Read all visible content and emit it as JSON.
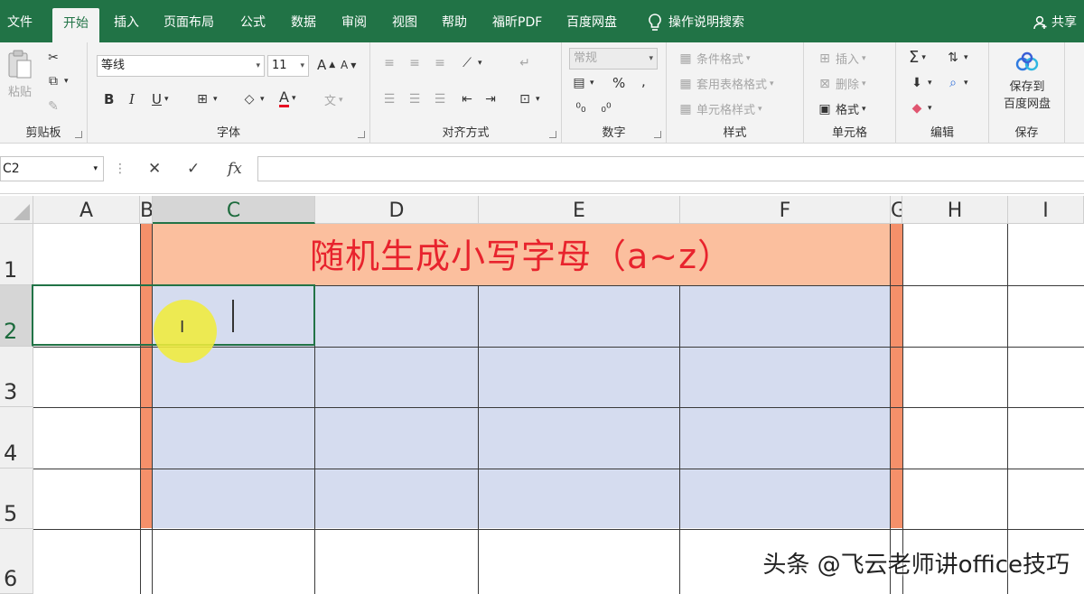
{
  "tabs": [
    {
      "label": "文件",
      "active": false
    },
    {
      "label": "开始",
      "active": true
    },
    {
      "label": "插入",
      "active": false
    },
    {
      "label": "页面布局",
      "active": false
    },
    {
      "label": "公式",
      "active": false
    },
    {
      "label": "数据",
      "active": false
    },
    {
      "label": "审阅",
      "active": false
    },
    {
      "label": "视图",
      "active": false
    },
    {
      "label": "帮助",
      "active": false
    },
    {
      "label": "福昕PDF",
      "active": false
    },
    {
      "label": "百度网盘",
      "active": false
    }
  ],
  "search_label": "操作说明搜索",
  "share_label": "共享",
  "ribbon": {
    "clipboard": {
      "group": "剪贴板",
      "paste": "粘贴"
    },
    "font": {
      "group": "字体",
      "family": "等线",
      "size": "11",
      "bold": "B",
      "italic": "I",
      "underline": "U",
      "font_color_letter": "A",
      "grow_letter": "A",
      "shrink_letter": "A",
      "phonetic": "文"
    },
    "alignment": {
      "group": "对齐方式"
    },
    "number": {
      "group": "数字",
      "format": "常规",
      "percent": "%",
      "comma": ","
    },
    "styles": {
      "group": "样式",
      "conditional": "条件格式",
      "table": "套用表格格式",
      "cell_styles": "单元格样式"
    },
    "cells": {
      "group": "单元格",
      "insert": "插入",
      "delete": "删除",
      "format": "格式"
    },
    "editing": {
      "group": "编辑",
      "sigma": "Σ"
    },
    "save": {
      "group": "保存",
      "line1": "保存到",
      "line2": "百度网盘"
    }
  },
  "formula_bar": {
    "name_box": "C2",
    "cancel": "✕",
    "enter": "✓",
    "fx": "fx",
    "value": ""
  },
  "columns": [
    "A",
    "B",
    "C",
    "D",
    "E",
    "F",
    "G",
    "H",
    "I"
  ],
  "rows": [
    "1",
    "2",
    "3",
    "4",
    "5",
    "6"
  ],
  "selected_column": "C",
  "selected_row": "2",
  "sheet_title": "随机生成小写字母（a~z）",
  "colors": {
    "ribbon_green": "#217346",
    "title_red": "#e8232d",
    "band_orange": "#f9c2a8",
    "range_blue": "#d5dcef",
    "highlight_yellow": "#f0ec3c"
  },
  "watermark": "头条 @飞云老师讲office技巧"
}
